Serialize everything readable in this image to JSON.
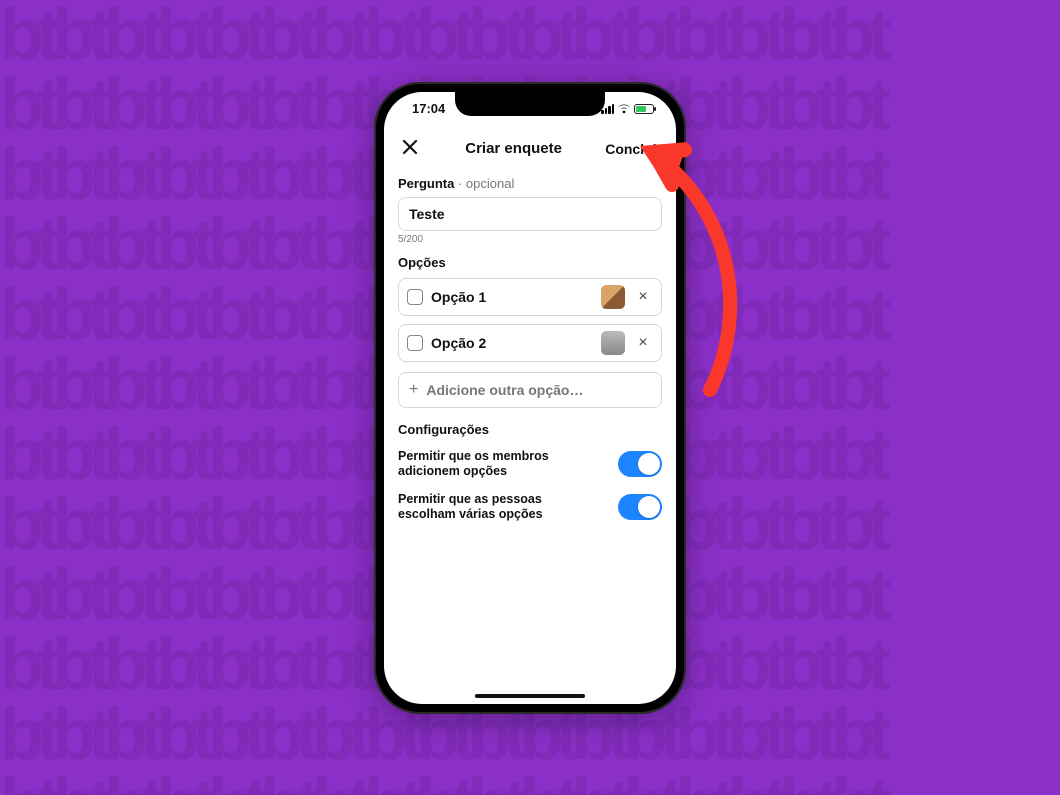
{
  "status": {
    "time": "17:04"
  },
  "header": {
    "title": "Criar enquete",
    "done_label": "Concluir"
  },
  "question": {
    "label": "Pergunta",
    "optional_label": "opcional",
    "value": "Teste",
    "char_count": "5/200"
  },
  "options_section_label": "Opções",
  "options": [
    {
      "label": "Opção 1"
    },
    {
      "label": "Opção 2"
    }
  ],
  "add_option_label": "Adicione outra opção…",
  "settings_label": "Configurações",
  "settings": {
    "allow_members_add": {
      "label": "Permitir que os membros adicionem opções",
      "on": true
    },
    "allow_multiple": {
      "label": "Permitir que as pessoas escolham várias opções",
      "on": true
    }
  },
  "colors": {
    "background": "#8a2fc7",
    "accent_toggle": "#1d85ff",
    "annotation": "#f9382b"
  }
}
